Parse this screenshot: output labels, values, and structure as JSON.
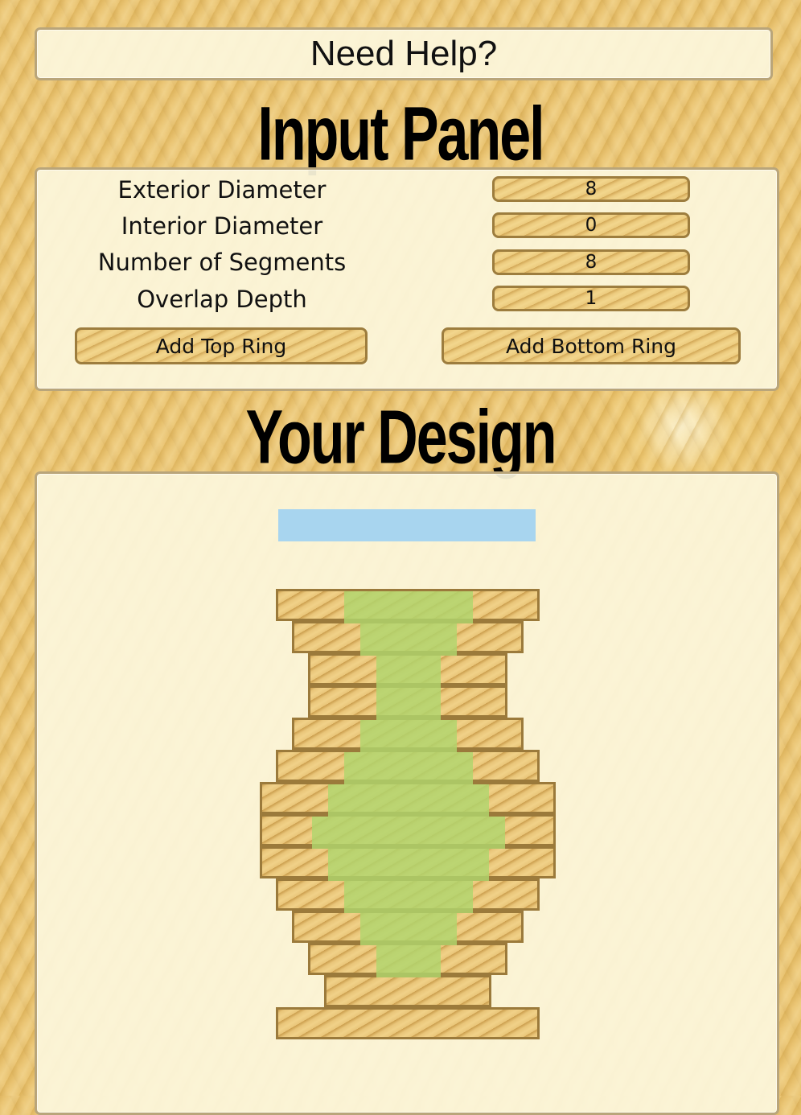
{
  "help": {
    "label": "Need Help?"
  },
  "input_panel": {
    "heading": "Input Panel",
    "fields": [
      {
        "label": "Exterior Diameter",
        "value": "8"
      },
      {
        "label": "Interior Diameter",
        "value": "0"
      },
      {
        "label": "Number of Segments",
        "value": "8"
      },
      {
        "label": "Overlap Depth",
        "value": "1"
      }
    ],
    "add_top_ring_label": "Add Top Ring",
    "add_bottom_ring_label": "Add Bottom Ring"
  },
  "design": {
    "heading": "Your Design",
    "colors": {
      "ring": "#e9c579",
      "ring_border": "#9b7a3b",
      "core": "#b0d66e",
      "top_bar": "#a8d5ef"
    }
  }
}
